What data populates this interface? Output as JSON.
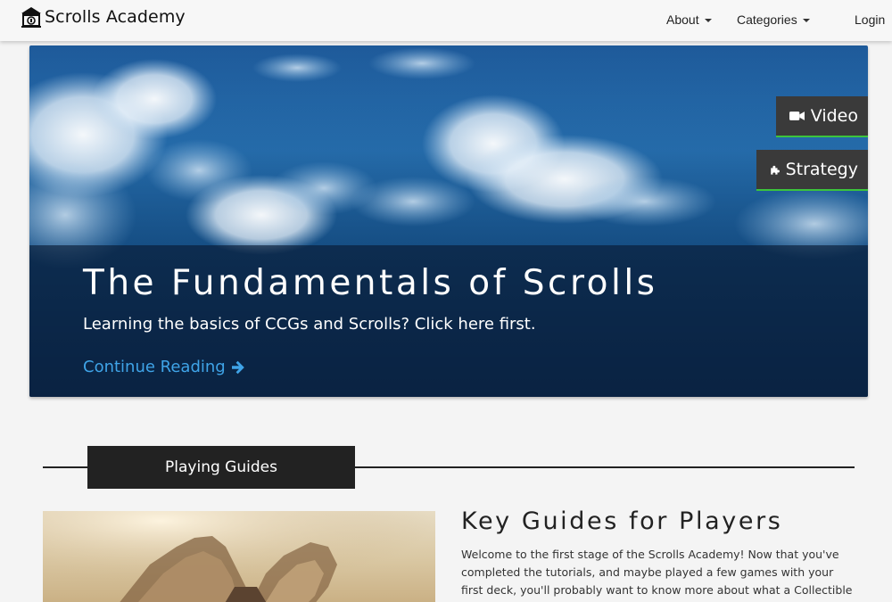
{
  "navbar": {
    "brand": "Scrolls Academy",
    "brand_icon": "academy-building-icon",
    "about_label": "About",
    "categories_label": "Categories",
    "login_label": "Login"
  },
  "hero": {
    "title": "The Fundamentals of Scrolls",
    "subtitle": "Learning the basics of CCGs and Scrolls? Click here first.",
    "link_label": "Continue Reading",
    "link_icon": "arrow-right-icon",
    "tags": [
      {
        "label": "Video",
        "icon": "video-camera-icon"
      },
      {
        "label": "Strategy",
        "icon": "puzzle-piece-icon"
      }
    ],
    "accent_color": "#3cc43c",
    "link_color": "#3fa4e8"
  },
  "section": {
    "label": "Playing Guides"
  },
  "article": {
    "title": "Key Guides for Players",
    "body": "Welcome to the first stage of the Scrolls Academy! Now that you've completed the tutorials, and maybe played a few games with your first deck, you'll probably want to know more about what a Collectible Card"
  }
}
